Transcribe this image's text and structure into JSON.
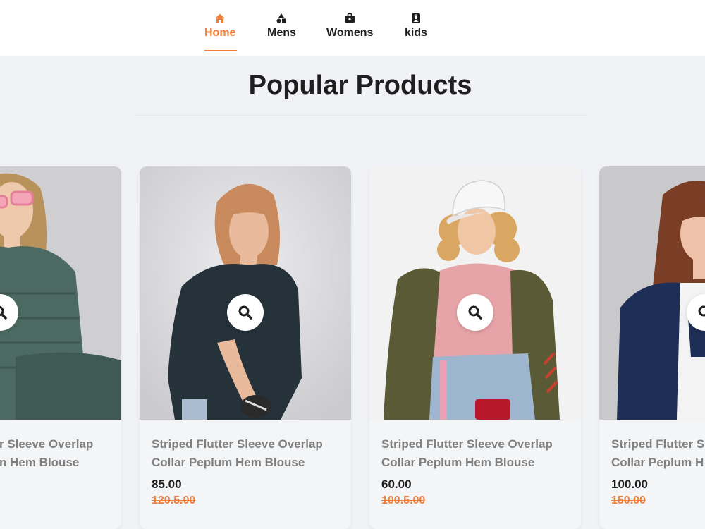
{
  "nav": {
    "items": [
      {
        "label": "Home",
        "icon": "home-icon",
        "active": true
      },
      {
        "label": "Mens",
        "icon": "shapes-icon",
        "active": false
      },
      {
        "label": "Womens",
        "icon": "briefcase-icon",
        "active": false
      },
      {
        "label": "kids",
        "icon": "id-badge-icon",
        "active": false
      }
    ]
  },
  "section": {
    "title": "Popular Products"
  },
  "colors": {
    "accent": "#f07f3c",
    "text": "#1f1f1f",
    "muted": "#808080",
    "background": "#f1f2f5"
  },
  "products": [
    {
      "name": "Striped Flutter Sleeve Overlap Collar Peplum Hem Blouse",
      "name_line1": "r Sleeve Overlap",
      "name_line2": "n Hem Blouse",
      "price": "",
      "old_price": "",
      "image": "model-green-puffer-jacket"
    },
    {
      "name": "Striped Flutter Sleeve Overlap Collar Peplum Hem Blouse",
      "name_line1": "Striped Flutter Sleeve Overlap",
      "name_line2": "Collar Peplum Hem Blouse",
      "price": "85.00",
      "old_price": "120.5.00",
      "image": "model-navy-oversized-tee"
    },
    {
      "name": "Striped Flutter Sleeve Overlap Collar Peplum Hem Blouse",
      "name_line1": "Striped Flutter Sleeve Overlap",
      "name_line2": "Collar Peplum Hem Blouse",
      "price": "60.00",
      "old_price": "100.5.00",
      "image": "model-pink-sweater-bomber"
    },
    {
      "name": "Striped Flutter Sleeve Overlap Collar Peplum Hem Blouse",
      "name_line1": "Striped Flutter S",
      "name_line2": "Collar Peplum H",
      "price": "100.00",
      "old_price": "150.00",
      "image": "model-long-hair-jacket"
    }
  ]
}
